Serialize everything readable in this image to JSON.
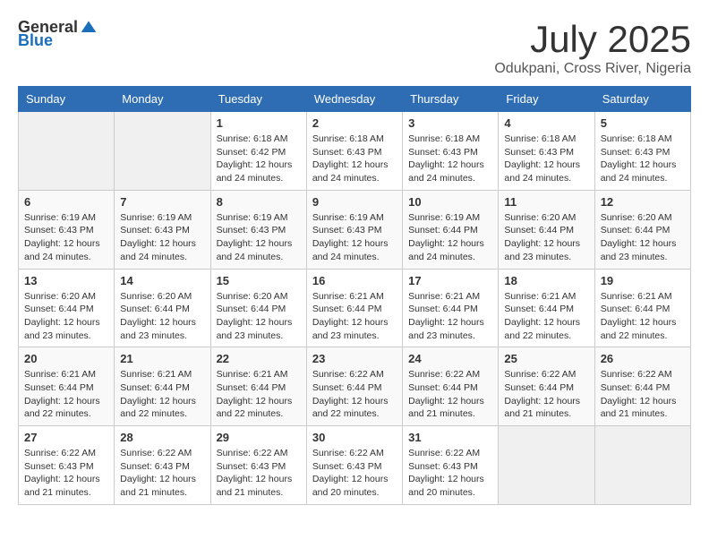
{
  "logo": {
    "text_general": "General",
    "text_blue": "Blue",
    "tagline": ""
  },
  "header": {
    "title": "July 2025",
    "subtitle": "Odukpani, Cross River, Nigeria"
  },
  "weekdays": [
    "Sunday",
    "Monday",
    "Tuesday",
    "Wednesday",
    "Thursday",
    "Friday",
    "Saturday"
  ],
  "weeks": [
    [
      {
        "day": "",
        "empty": true
      },
      {
        "day": "",
        "empty": true
      },
      {
        "day": "1",
        "sunrise": "Sunrise: 6:18 AM",
        "sunset": "Sunset: 6:42 PM",
        "daylight": "Daylight: 12 hours and 24 minutes."
      },
      {
        "day": "2",
        "sunrise": "Sunrise: 6:18 AM",
        "sunset": "Sunset: 6:43 PM",
        "daylight": "Daylight: 12 hours and 24 minutes."
      },
      {
        "day": "3",
        "sunrise": "Sunrise: 6:18 AM",
        "sunset": "Sunset: 6:43 PM",
        "daylight": "Daylight: 12 hours and 24 minutes."
      },
      {
        "day": "4",
        "sunrise": "Sunrise: 6:18 AM",
        "sunset": "Sunset: 6:43 PM",
        "daylight": "Daylight: 12 hours and 24 minutes."
      },
      {
        "day": "5",
        "sunrise": "Sunrise: 6:18 AM",
        "sunset": "Sunset: 6:43 PM",
        "daylight": "Daylight: 12 hours and 24 minutes."
      }
    ],
    [
      {
        "day": "6",
        "sunrise": "Sunrise: 6:19 AM",
        "sunset": "Sunset: 6:43 PM",
        "daylight": "Daylight: 12 hours and 24 minutes."
      },
      {
        "day": "7",
        "sunrise": "Sunrise: 6:19 AM",
        "sunset": "Sunset: 6:43 PM",
        "daylight": "Daylight: 12 hours and 24 minutes."
      },
      {
        "day": "8",
        "sunrise": "Sunrise: 6:19 AM",
        "sunset": "Sunset: 6:43 PM",
        "daylight": "Daylight: 12 hours and 24 minutes."
      },
      {
        "day": "9",
        "sunrise": "Sunrise: 6:19 AM",
        "sunset": "Sunset: 6:43 PM",
        "daylight": "Daylight: 12 hours and 24 minutes."
      },
      {
        "day": "10",
        "sunrise": "Sunrise: 6:19 AM",
        "sunset": "Sunset: 6:44 PM",
        "daylight": "Daylight: 12 hours and 24 minutes."
      },
      {
        "day": "11",
        "sunrise": "Sunrise: 6:20 AM",
        "sunset": "Sunset: 6:44 PM",
        "daylight": "Daylight: 12 hours and 23 minutes."
      },
      {
        "day": "12",
        "sunrise": "Sunrise: 6:20 AM",
        "sunset": "Sunset: 6:44 PM",
        "daylight": "Daylight: 12 hours and 23 minutes."
      }
    ],
    [
      {
        "day": "13",
        "sunrise": "Sunrise: 6:20 AM",
        "sunset": "Sunset: 6:44 PM",
        "daylight": "Daylight: 12 hours and 23 minutes."
      },
      {
        "day": "14",
        "sunrise": "Sunrise: 6:20 AM",
        "sunset": "Sunset: 6:44 PM",
        "daylight": "Daylight: 12 hours and 23 minutes."
      },
      {
        "day": "15",
        "sunrise": "Sunrise: 6:20 AM",
        "sunset": "Sunset: 6:44 PM",
        "daylight": "Daylight: 12 hours and 23 minutes."
      },
      {
        "day": "16",
        "sunrise": "Sunrise: 6:21 AM",
        "sunset": "Sunset: 6:44 PM",
        "daylight": "Daylight: 12 hours and 23 minutes."
      },
      {
        "day": "17",
        "sunrise": "Sunrise: 6:21 AM",
        "sunset": "Sunset: 6:44 PM",
        "daylight": "Daylight: 12 hours and 23 minutes."
      },
      {
        "day": "18",
        "sunrise": "Sunrise: 6:21 AM",
        "sunset": "Sunset: 6:44 PM",
        "daylight": "Daylight: 12 hours and 22 minutes."
      },
      {
        "day": "19",
        "sunrise": "Sunrise: 6:21 AM",
        "sunset": "Sunset: 6:44 PM",
        "daylight": "Daylight: 12 hours and 22 minutes."
      }
    ],
    [
      {
        "day": "20",
        "sunrise": "Sunrise: 6:21 AM",
        "sunset": "Sunset: 6:44 PM",
        "daylight": "Daylight: 12 hours and 22 minutes."
      },
      {
        "day": "21",
        "sunrise": "Sunrise: 6:21 AM",
        "sunset": "Sunset: 6:44 PM",
        "daylight": "Daylight: 12 hours and 22 minutes."
      },
      {
        "day": "22",
        "sunrise": "Sunrise: 6:21 AM",
        "sunset": "Sunset: 6:44 PM",
        "daylight": "Daylight: 12 hours and 22 minutes."
      },
      {
        "day": "23",
        "sunrise": "Sunrise: 6:22 AM",
        "sunset": "Sunset: 6:44 PM",
        "daylight": "Daylight: 12 hours and 22 minutes."
      },
      {
        "day": "24",
        "sunrise": "Sunrise: 6:22 AM",
        "sunset": "Sunset: 6:44 PM",
        "daylight": "Daylight: 12 hours and 21 minutes."
      },
      {
        "day": "25",
        "sunrise": "Sunrise: 6:22 AM",
        "sunset": "Sunset: 6:44 PM",
        "daylight": "Daylight: 12 hours and 21 minutes."
      },
      {
        "day": "26",
        "sunrise": "Sunrise: 6:22 AM",
        "sunset": "Sunset: 6:44 PM",
        "daylight": "Daylight: 12 hours and 21 minutes."
      }
    ],
    [
      {
        "day": "27",
        "sunrise": "Sunrise: 6:22 AM",
        "sunset": "Sunset: 6:43 PM",
        "daylight": "Daylight: 12 hours and 21 minutes."
      },
      {
        "day": "28",
        "sunrise": "Sunrise: 6:22 AM",
        "sunset": "Sunset: 6:43 PM",
        "daylight": "Daylight: 12 hours and 21 minutes."
      },
      {
        "day": "29",
        "sunrise": "Sunrise: 6:22 AM",
        "sunset": "Sunset: 6:43 PM",
        "daylight": "Daylight: 12 hours and 21 minutes."
      },
      {
        "day": "30",
        "sunrise": "Sunrise: 6:22 AM",
        "sunset": "Sunset: 6:43 PM",
        "daylight": "Daylight: 12 hours and 20 minutes."
      },
      {
        "day": "31",
        "sunrise": "Sunrise: 6:22 AM",
        "sunset": "Sunset: 6:43 PM",
        "daylight": "Daylight: 12 hours and 20 minutes."
      },
      {
        "day": "",
        "empty": true
      },
      {
        "day": "",
        "empty": true
      }
    ]
  ]
}
